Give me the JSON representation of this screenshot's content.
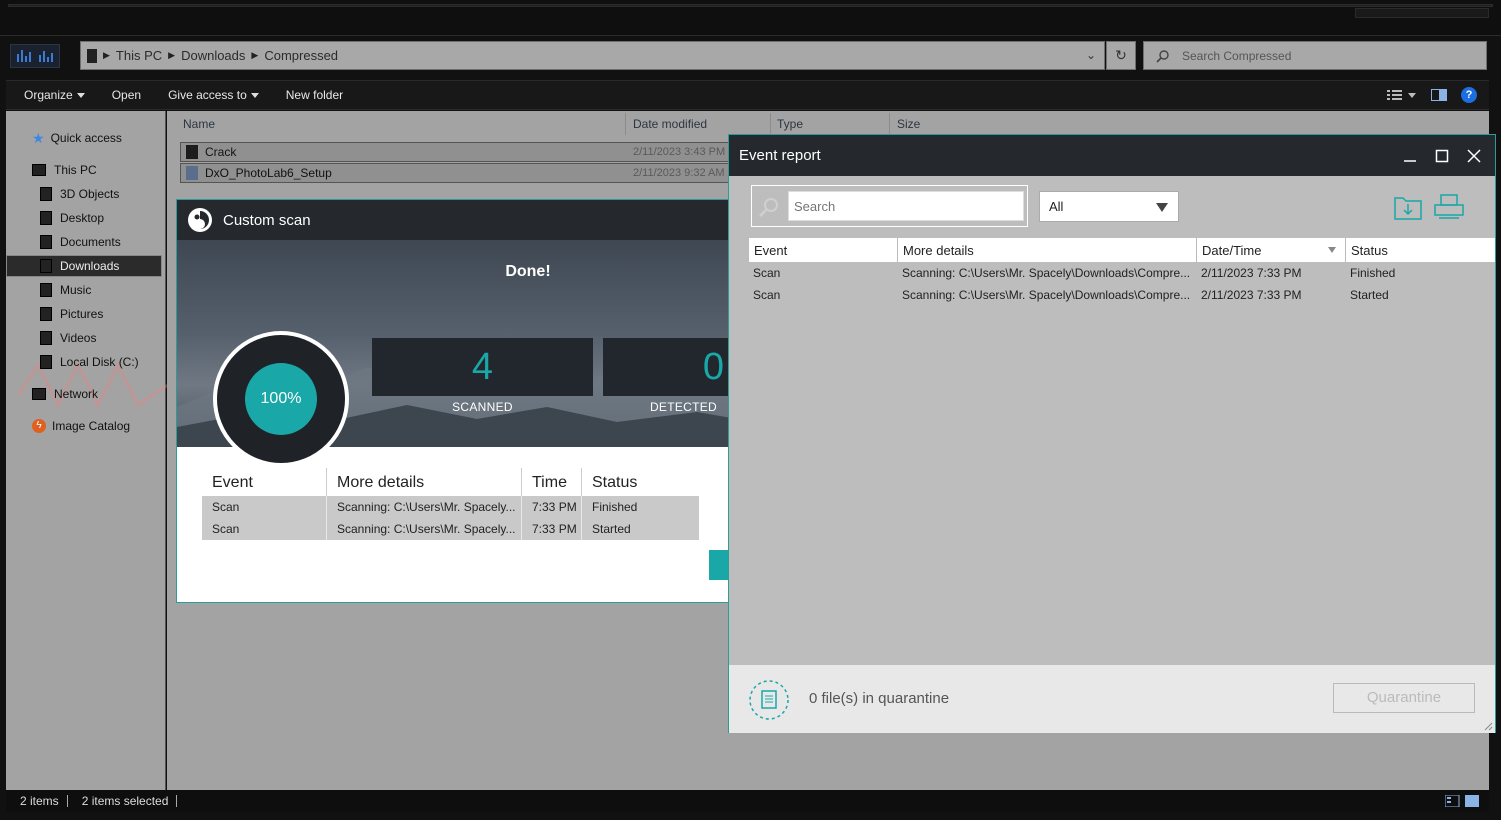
{
  "explorer": {
    "breadcrumb": [
      "This PC",
      "Downloads",
      "Compressed"
    ],
    "search_placeholder": "Search Compressed",
    "commands": [
      "Organize",
      "Open",
      "Give access to",
      "New folder"
    ],
    "nav": {
      "quick_access": "Quick access",
      "this_pc": "This PC",
      "items": [
        "3D Objects",
        "Desktop",
        "Documents",
        "Downloads",
        "Music",
        "Pictures",
        "Videos",
        "Local Disk (C:)"
      ],
      "network": "Network",
      "image_catalog": "Image Catalog"
    },
    "columns": [
      "Name",
      "Date modified",
      "Type",
      "Size"
    ],
    "files": [
      {
        "name": "Crack",
        "date": "2/11/2023 3:43 PM"
      },
      {
        "name": "DxO_PhotoLab6_Setup",
        "date": "2/11/2023 9:32 AM"
      }
    ],
    "status": {
      "items": "2 items",
      "selected": "2 items selected"
    }
  },
  "scan": {
    "title": "Custom scan",
    "done_label": "Done!",
    "progress": "100%",
    "scanned_value": "4",
    "scanned_label": "SCANNED",
    "detected_value": "0",
    "detected_label": "DETECTED",
    "columns": [
      "Event",
      "More details",
      "Time",
      "Status"
    ],
    "rows": [
      {
        "event": "Scan",
        "details": "Scanning: C:\\Users\\Mr. Spacely...",
        "time": "7:33 PM",
        "status": "Finished"
      },
      {
        "event": "Scan",
        "details": "Scanning: C:\\Users\\Mr. Spacely...",
        "time": "7:33 PM",
        "status": "Started"
      }
    ]
  },
  "event_report": {
    "title": "Event report",
    "search_placeholder": "Search",
    "filter_value": "All",
    "columns": [
      "Event",
      "More details",
      "Date/Time",
      "Status"
    ],
    "rows": [
      {
        "event": "Scan",
        "details": "Scanning: C:\\Users\\Mr. Spacely\\Downloads\\Compre...",
        "datetime": "2/11/2023 7:33 PM",
        "status": "Finished"
      },
      {
        "event": "Scan",
        "details": "Scanning: C:\\Users\\Mr. Spacely\\Downloads\\Compre...",
        "datetime": "2/11/2023 7:33 PM",
        "status": "Started"
      }
    ],
    "quarantine_text": "0 file(s) in quarantine",
    "quarantine_button": "Quarantine"
  },
  "colors": {
    "accent_teal": "#1aa7a7",
    "dark_titlebar": "#25282d",
    "explorer_bg": "#a3a3a3"
  }
}
